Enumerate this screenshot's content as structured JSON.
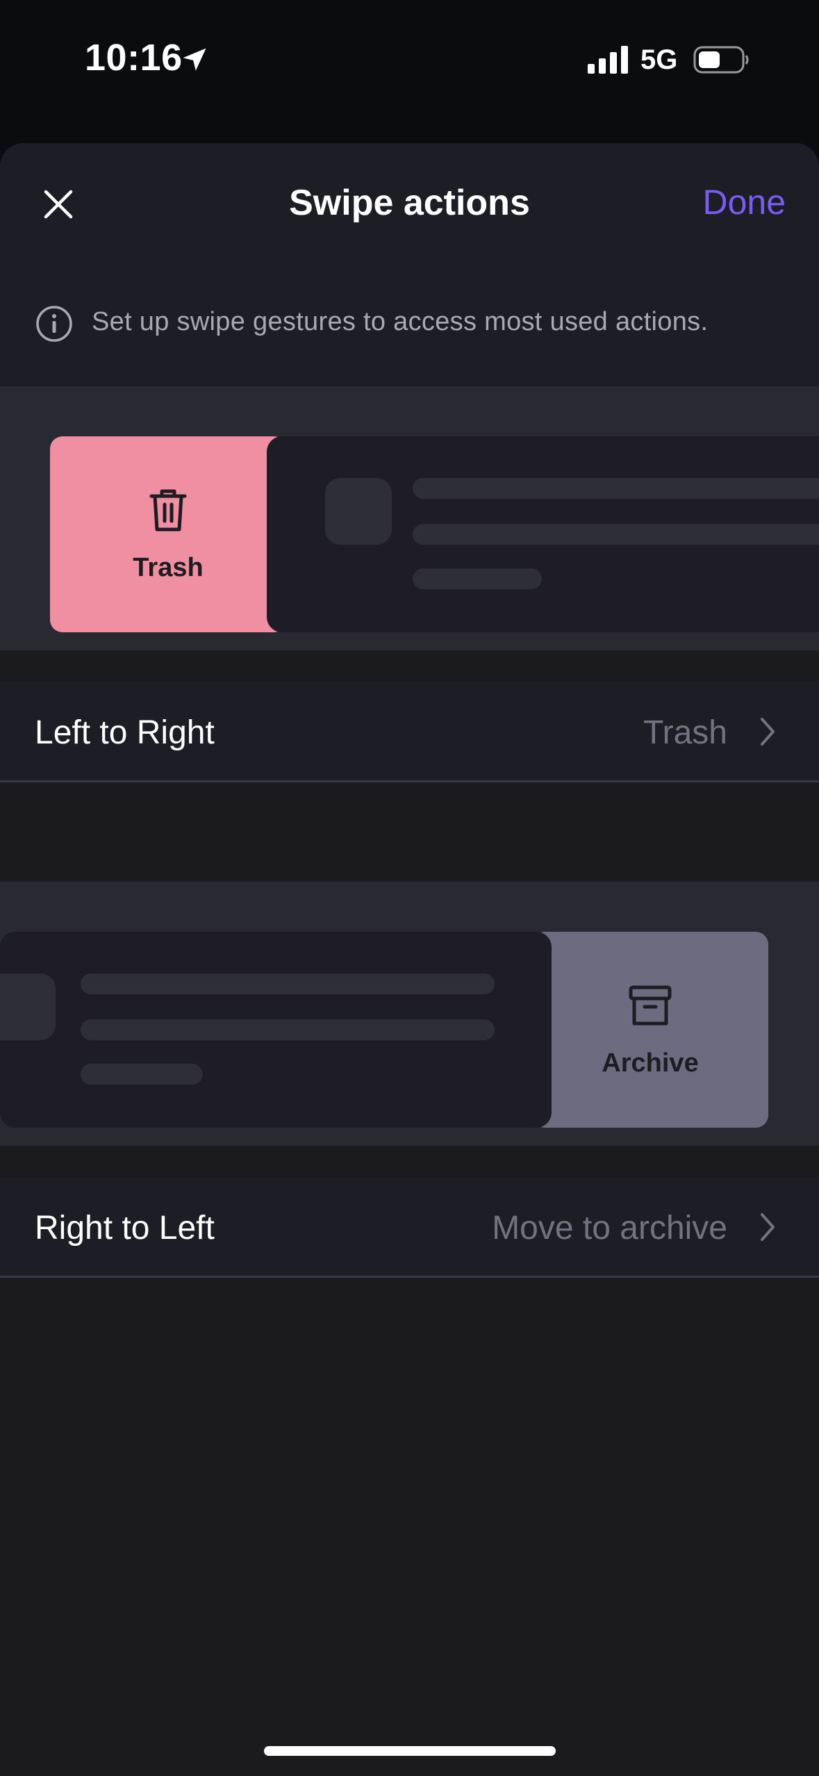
{
  "status_bar": {
    "time": "10:16",
    "network": "5G"
  },
  "header": {
    "title": "Swipe actions",
    "done_label": "Done",
    "info_text": "Set up swipe gestures to access most used actions."
  },
  "left_to_right": {
    "preview_label": "Trash",
    "row_label": "Left to Right",
    "row_value": "Trash",
    "tile_color": "#f08fa1"
  },
  "right_to_left": {
    "preview_label": "Archive",
    "row_label": "Right to Left",
    "row_value": "Move to archive",
    "tile_color": "#6d6b7f"
  },
  "colors": {
    "accent": "#7a5cf5",
    "background": "#1b1b1e"
  },
  "icons": [
    "close-icon",
    "info-icon",
    "trash-icon",
    "archive-icon",
    "chevron-right-icon",
    "location-arrow-icon",
    "signal-icon",
    "battery-icon"
  ]
}
